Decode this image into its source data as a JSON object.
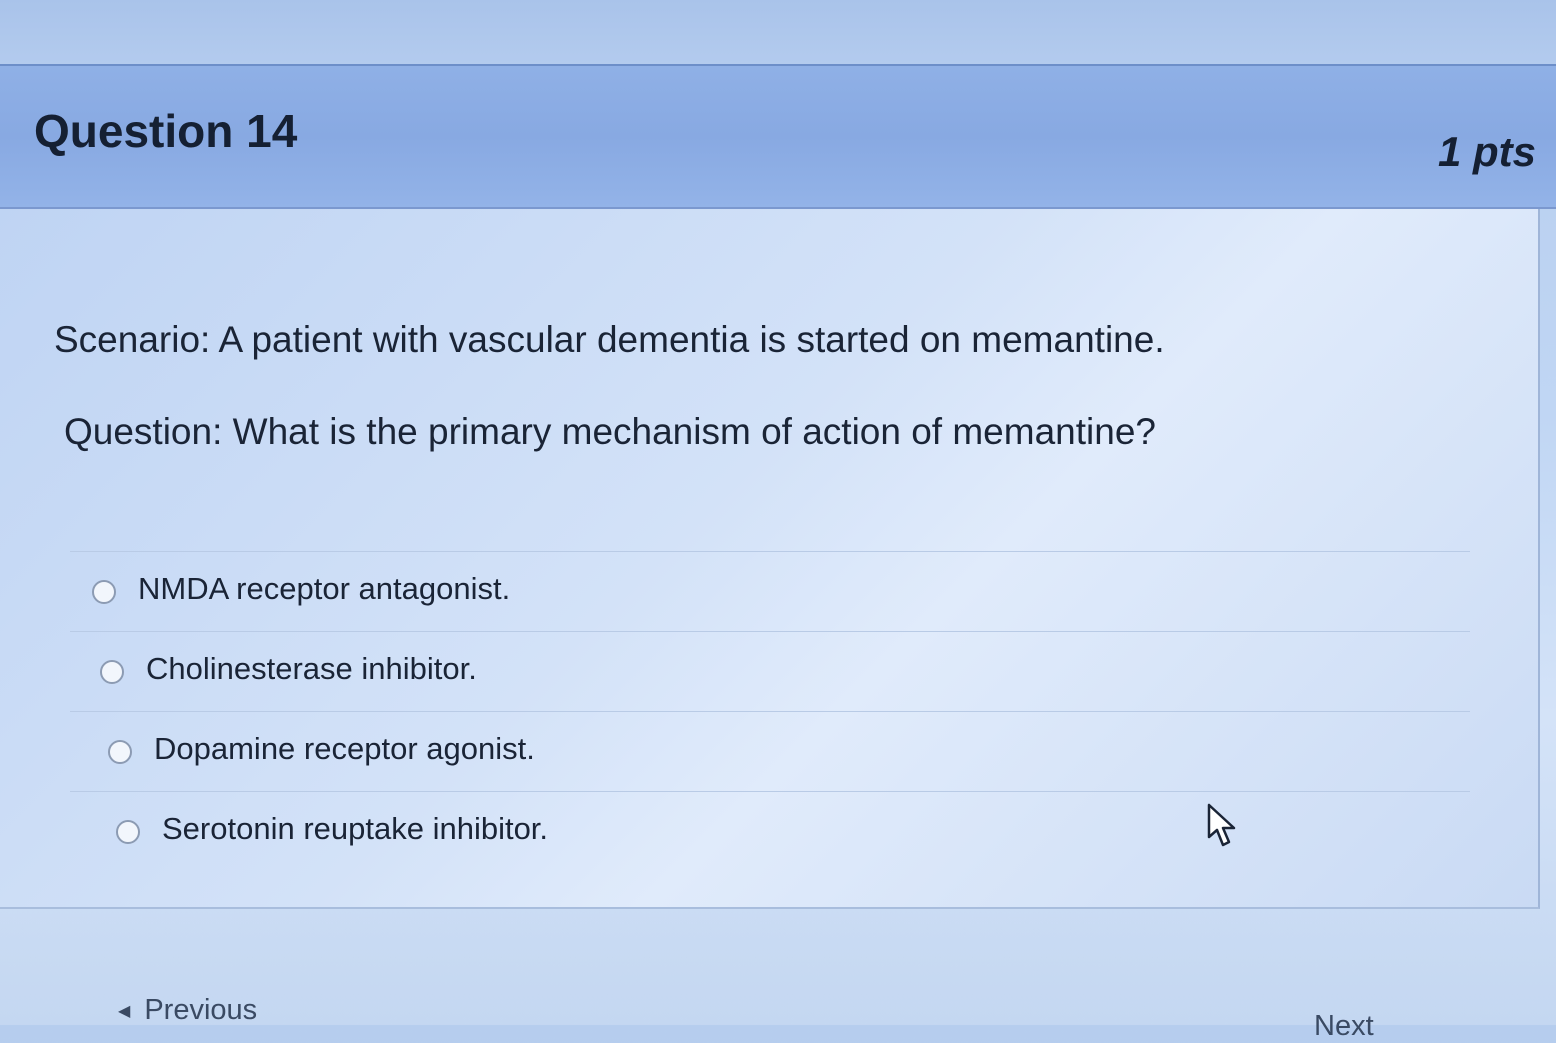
{
  "question": {
    "title": "Question 14",
    "points": "1 pts",
    "scenario": "Scenario: A patient with vascular dementia is started on memantine.",
    "prompt": "Question: What is the primary mechanism of action of memantine?",
    "answers": [
      {
        "label": "NMDA receptor antagonist.",
        "selected": false
      },
      {
        "label": "Cholinesterase inhibitor.",
        "selected": false
      },
      {
        "label": "Dopamine receptor agonist.",
        "selected": false
      },
      {
        "label": "Serotonin reuptake inhibitor.",
        "selected": false
      }
    ]
  },
  "navigation": {
    "previous_label": "Previous",
    "next_label": "Next"
  },
  "icons": {
    "previous_arrow": "triangle-left-icon",
    "cursor": "mouse-pointer-icon"
  },
  "colors": {
    "header_background": "#8fb0e6",
    "body_background": "#d3e2f8",
    "text": "#1a2436"
  }
}
